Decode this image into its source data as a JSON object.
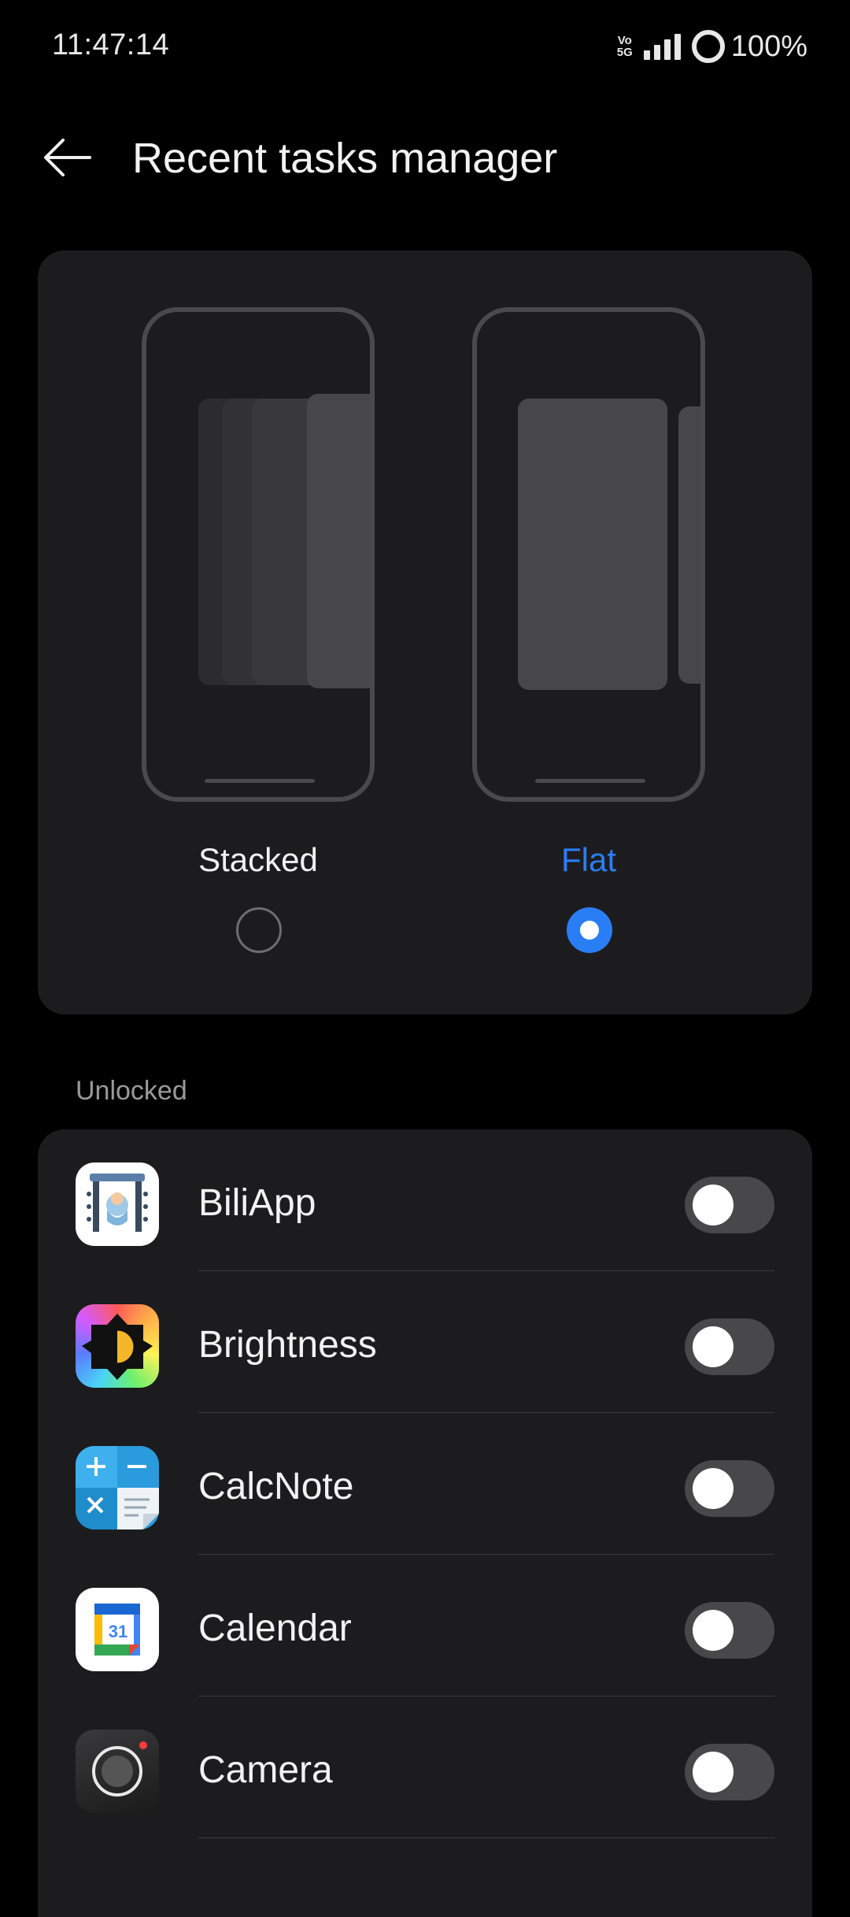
{
  "status_bar": {
    "time": "11:47:14",
    "network_top": "Vo",
    "network_bottom": "5G",
    "battery": "100%"
  },
  "header": {
    "title": "Recent tasks manager",
    "back_icon": "arrow-left-icon"
  },
  "layout_options": [
    {
      "label": "Stacked",
      "selected": false
    },
    {
      "label": "Flat",
      "selected": true
    }
  ],
  "colors": {
    "accent": "#2a7ef5",
    "card": "#1c1c1e",
    "background": "#000000"
  },
  "section": {
    "label": "Unlocked"
  },
  "apps": [
    {
      "name": "BiliApp",
      "icon": "biliapp-icon",
      "locked": false
    },
    {
      "name": "Brightness",
      "icon": "brightness-icon",
      "locked": false
    },
    {
      "name": "CalcNote",
      "icon": "calcnote-icon",
      "locked": false
    },
    {
      "name": "Calendar",
      "icon": "calendar-icon",
      "locked": false,
      "icon_text": "31"
    },
    {
      "name": "Camera",
      "icon": "camera-icon",
      "locked": false
    }
  ]
}
